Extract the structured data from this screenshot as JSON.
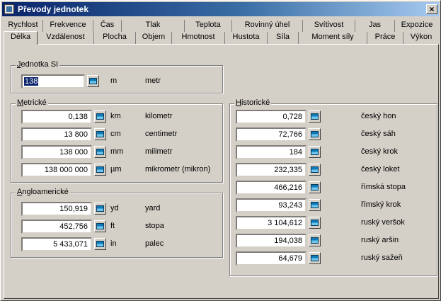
{
  "window": {
    "title": "Převody jednotek",
    "close_label": "×"
  },
  "tabs_row1": [
    "Rychlost",
    "Frekvence",
    "Čas",
    "Tlak",
    "Teplota",
    "Rovinný úhel",
    "Svítivost",
    "Jas",
    "Expozice"
  ],
  "tabs_row2": [
    "Délka",
    "Vzdálenost",
    "Plocha",
    "Objem",
    "Hmotnost",
    "Hustota",
    "Síla",
    "Moment síly",
    "Práce",
    "Výkon"
  ],
  "si": {
    "legend": "Jednotka SI",
    "value": "138",
    "unit_abbr": "m",
    "unit_name": "metr"
  },
  "metric": {
    "legend": "Metrické",
    "rows": [
      {
        "value": "0,138",
        "unit_abbr": "km",
        "unit_name": "kilometr"
      },
      {
        "value": "13 800",
        "unit_abbr": "cm",
        "unit_name": "centimetr"
      },
      {
        "value": "138 000",
        "unit_abbr": "mm",
        "unit_name": "milimetr"
      },
      {
        "value": "138 000 000",
        "unit_abbr": "µm",
        "unit_name": "mikrometr (mikron)"
      }
    ]
  },
  "anglo": {
    "legend": "Angloamerické",
    "rows": [
      {
        "value": "150,919",
        "unit_abbr": "yd",
        "unit_name": "yard"
      },
      {
        "value": "452,756",
        "unit_abbr": "ft",
        "unit_name": "stopa"
      },
      {
        "value": "5 433,071",
        "unit_abbr": "in",
        "unit_name": "palec"
      }
    ]
  },
  "historic": {
    "legend": "Historické",
    "rows": [
      {
        "value": "0,728",
        "unit_name": "český hon"
      },
      {
        "value": "72,766",
        "unit_name": "český sáh"
      },
      {
        "value": "184",
        "unit_name": "český krok"
      },
      {
        "value": "232,335",
        "unit_name": "český loket"
      },
      {
        "value": "466,216",
        "unit_name": "římská stopa"
      },
      {
        "value": "93,243",
        "unit_name": "římský krok"
      },
      {
        "value": "3 104,612",
        "unit_name": "ruský veršok"
      },
      {
        "value": "194,038",
        "unit_name": "ruský aršin"
      },
      {
        "value": "64,679",
        "unit_name": "ruský sažeň"
      }
    ]
  },
  "icons": {
    "title_icon": "app-icon",
    "calc_button_icon": "calculator-icon",
    "close_icon": "close-icon"
  },
  "colors": {
    "titlebar_start": "#0a246a",
    "titlebar_end": "#a6caf0",
    "face": "#d4d0c8",
    "selection": "#0a246a"
  }
}
